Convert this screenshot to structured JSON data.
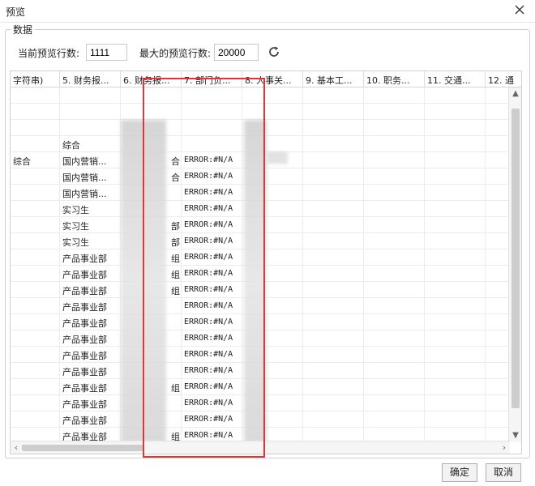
{
  "window": {
    "title": "预览"
  },
  "group": {
    "legend": "数据"
  },
  "fields": {
    "current_label": "当前预览行数:",
    "current_value": "1111",
    "max_label": "最大的预览行数:",
    "max_value": "20000"
  },
  "columns": [
    {
      "label": "字符串)"
    },
    {
      "label": "5. 财务报..."
    },
    {
      "label": "6. 财务报..."
    },
    {
      "label": "7. 部门负..."
    },
    {
      "label": "8. 人事关..."
    },
    {
      "label": "9. 基本工..."
    },
    {
      "label": "10. 职务..."
    },
    {
      "label": "11. 交通..."
    },
    {
      "label": "12. 通"
    }
  ],
  "rows": [
    {
      "c0": "",
      "c1": "",
      "c2": "",
      "c3": ""
    },
    {
      "c0": "",
      "c1": "",
      "c2": "",
      "c3": ""
    },
    {
      "c0": "",
      "c1": "",
      "c2": "",
      "c3": ""
    },
    {
      "c0": "",
      "c1": "综合",
      "c2": "",
      "c3": ""
    },
    {
      "c0": "综合",
      "c1": "国内营销...",
      "c2": "合",
      "c3": "ERROR:#N/A"
    },
    {
      "c0": "",
      "c1": "国内营销...",
      "c2": "合",
      "c3": "ERROR:#N/A"
    },
    {
      "c0": "",
      "c1": "国内营销...",
      "c2": "",
      "c3": "ERROR:#N/A"
    },
    {
      "c0": "",
      "c1": "实习生",
      "c2": "",
      "c3": "ERROR:#N/A"
    },
    {
      "c0": "",
      "c1": "实习生",
      "c2": "部",
      "c3": "ERROR:#N/A"
    },
    {
      "c0": "",
      "c1": "实习生",
      "c2": "部",
      "c3": "ERROR:#N/A"
    },
    {
      "c0": "",
      "c1": "产品事业部",
      "c2": "组",
      "c3": "ERROR:#N/A"
    },
    {
      "c0": "",
      "c1": "产品事业部",
      "c2": "组",
      "c3": "ERROR:#N/A"
    },
    {
      "c0": "",
      "c1": "产品事业部",
      "c2": "组",
      "c3": "ERROR:#N/A"
    },
    {
      "c0": "",
      "c1": "产品事业部",
      "c2": "",
      "c3": "ERROR:#N/A"
    },
    {
      "c0": "",
      "c1": "产品事业部",
      "c2": "",
      "c3": "ERROR:#N/A"
    },
    {
      "c0": "",
      "c1": "产品事业部",
      "c2": "",
      "c3": "ERROR:#N/A"
    },
    {
      "c0": "",
      "c1": "产品事业部",
      "c2": "",
      "c3": "ERROR:#N/A"
    },
    {
      "c0": "",
      "c1": "产品事业部",
      "c2": "",
      "c3": "ERROR:#N/A"
    },
    {
      "c0": "",
      "c1": "产品事业部",
      "c2": "组",
      "c3": "ERROR:#N/A"
    },
    {
      "c0": "",
      "c1": "产品事业部",
      "c2": "",
      "c3": "ERROR:#N/A"
    },
    {
      "c0": "",
      "c1": "产品事业部",
      "c2": "",
      "c3": "ERROR:#N/A"
    },
    {
      "c0": "",
      "c1": "产品事业部",
      "c2": "组",
      "c3": "ERROR:#N/A"
    }
  ],
  "buttons": {
    "ok": "确定",
    "cancel": "取消"
  },
  "icons": {
    "close": "close-icon",
    "refresh": "refresh-icon"
  },
  "colors": {
    "highlight_box": "#e23636"
  }
}
